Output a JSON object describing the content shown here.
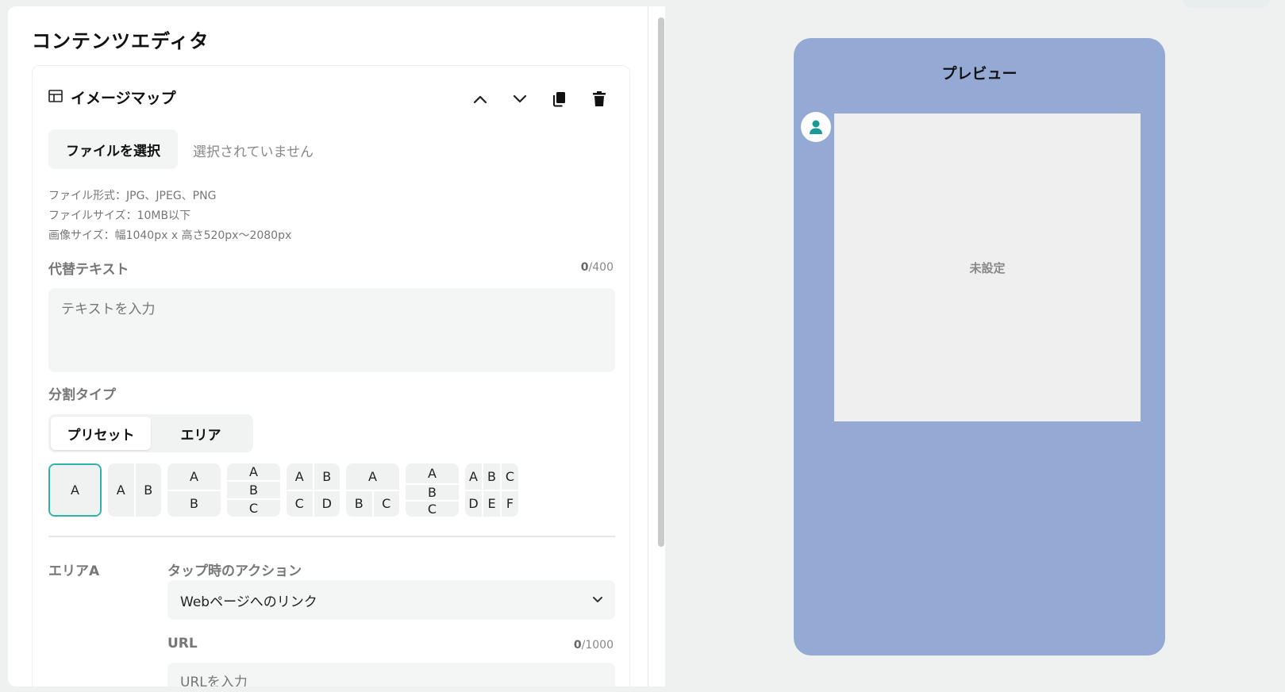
{
  "editor": {
    "title": "コンテンツエディタ"
  },
  "card": {
    "title": "イメージマップ",
    "tools": [
      "chevron-up-icon",
      "chevron-down-icon",
      "copy-icon",
      "trash-icon"
    ]
  },
  "file": {
    "button_label": "ファイルを選択",
    "status": "選択されていません",
    "info": [
      "ファイル形式：JPG、JPEG、PNG",
      "ファイルサイズ：10MB以下",
      "画像サイズ：幅1040px x 高さ520px〜2080px"
    ]
  },
  "alt_text": {
    "label": "代替テキスト",
    "count": "0",
    "max": "/400",
    "placeholder": "テキストを入力"
  },
  "split": {
    "label": "分割タイプ",
    "tabs": [
      "プリセット",
      "エリア"
    ],
    "active_tab": "プリセット",
    "presets": [
      [
        "A"
      ],
      [
        "A",
        "B"
      ],
      [
        "A",
        "B"
      ],
      [
        "A",
        "B",
        "C"
      ],
      [
        "A",
        "B",
        "C",
        "D"
      ],
      [
        "A",
        "B",
        "C"
      ],
      [
        "A",
        "B",
        "C"
      ],
      [
        "A",
        "B",
        "C",
        "D",
        "E",
        "F"
      ]
    ],
    "selected_preset": 0
  },
  "area": {
    "label": "エリアA",
    "action_label": "タップ時のアクション",
    "action_value": "Webページへのリンク",
    "url_label": "URL",
    "url_count": "0",
    "url_max": "/1000",
    "url_placeholder": "URLを入力"
  },
  "preview": {
    "title": "プレビュー",
    "image_status": "未設定",
    "background_color": "#94aad5"
  },
  "colors": {
    "accent": "#2fb3a8",
    "avatar_icon": "#1a9a96"
  }
}
